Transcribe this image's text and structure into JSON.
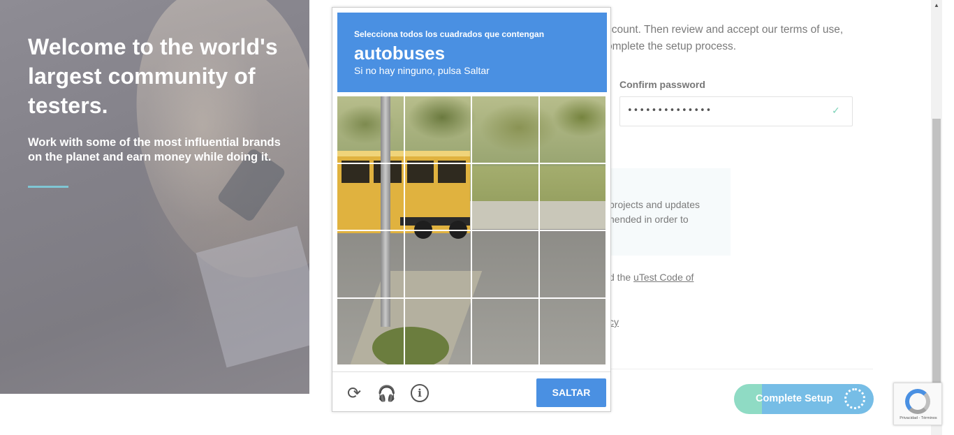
{
  "hero": {
    "title": "Welcome to the world's largest community of testers.",
    "subtitle": "Work with some of the most influential brands on the planet and earn money while doing it."
  },
  "form": {
    "intro": "ccount. Then review and accept our terms of use, omplete the setup process.",
    "confirm_label": "Confirm password",
    "confirm_value": "••••••••••••••",
    "info_text": "projects and updates nended in order to",
    "code_prefix": "d the ",
    "code_link": "uTest Code of",
    "policy_fragment": "cy",
    "complete_button": "Complete Setup"
  },
  "captcha": {
    "instruction": "Selecciona todos los cuadrados que contengan",
    "target": "autobuses",
    "hint": "Si no hay ninguno, pulsa Saltar",
    "skip_button": "SALTAR",
    "info_glyph": "i",
    "icons": [
      "reload-icon",
      "headphones-icon",
      "info-icon"
    ]
  },
  "recaptcha_badge": {
    "footer": "Privacidad - Términos"
  },
  "colors": {
    "captcha_blue": "#4a90e2",
    "setup_green": "#8fdbc4",
    "setup_blue": "#76bde6",
    "accent_rule": "#7fc6d4"
  }
}
